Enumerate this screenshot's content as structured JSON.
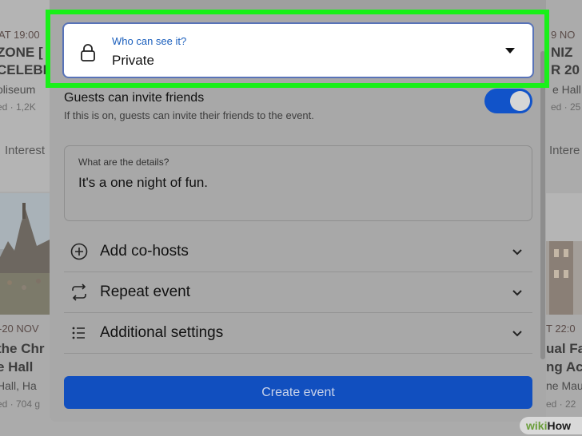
{
  "background": {
    "left": {
      "date1": "AT 19:00",
      "title1a": "ZONE [",
      "title1b": "CELEBR",
      "venue1": "oliseum",
      "stats1": "ed · 1,2K",
      "interest": "Interest",
      "date2": "-20 NOV",
      "title2a": "the Chr",
      "title2b": "e Hall",
      "venue2": "Hall, Ha",
      "stats2": "ed · 704 g"
    },
    "right": {
      "date1": "9 NO",
      "title1a": "NIZ",
      "title1b": "R 20",
      "venue1": "e Hall",
      "stats1": "ed · 25",
      "interest": "Intere",
      "date2": "T 22:0",
      "title2a": "ual Fa",
      "title2b": "ng Ac",
      "venue2": "ne Mau",
      "stats2": "ed · 22"
    }
  },
  "privacy": {
    "label": "Who can see it?",
    "value": "Private"
  },
  "guests": {
    "title": "Guests can invite friends",
    "description": "If this is on, guests can invite their friends to the event.",
    "enabled": true
  },
  "details": {
    "label": "What are the details?",
    "value": "It's a one night of fun."
  },
  "options": [
    {
      "label": "Add co-hosts",
      "icon": "plus-circle-icon"
    },
    {
      "label": "Repeat event",
      "icon": "repeat-icon"
    },
    {
      "label": "Additional settings",
      "icon": "list-icon"
    }
  ],
  "create_button": "Create event",
  "watermark": {
    "part1": "wiki",
    "part2": "How"
  },
  "colors": {
    "primary": "#114fbf",
    "highlight": "#19f019",
    "label_blue": "#1b5fbd"
  }
}
